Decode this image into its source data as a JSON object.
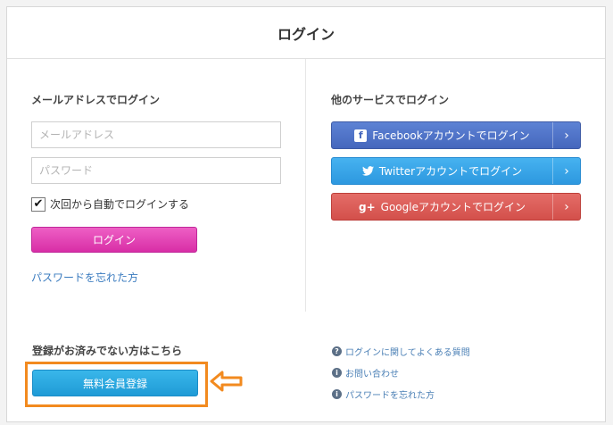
{
  "header": {
    "title": "ログイン"
  },
  "email_login": {
    "title": "メールアドレスでログイン",
    "email_placeholder": "メールアドレス",
    "password_placeholder": "パスワード",
    "remember_label": "次回から自動でログインする",
    "remember_checked": true,
    "login_button": "ログイン",
    "forgot_link": "パスワードを忘れた方"
  },
  "social_login": {
    "title": "他のサービスでログイン",
    "buttons": [
      {
        "label": "Facebookアカウントでログイン",
        "icon": "facebook-icon",
        "color": "#4a6bc2"
      },
      {
        "label": "Twitterアカウントでログイン",
        "icon": "twitter-icon",
        "color": "#34a2e6"
      },
      {
        "label": "Googleアカウントでログイン",
        "icon": "google-plus-icon",
        "glyph": "g+",
        "color": "#d85a55"
      }
    ],
    "arrow_glyph": "›"
  },
  "register": {
    "title": "登録がお済みでない方はこちら",
    "button": "無料会員登録",
    "highlight_color": "#f28a1f"
  },
  "help_links": [
    {
      "label": "ログインに関してよくある質問",
      "icon": "question-icon",
      "glyph": "?"
    },
    {
      "label": "お問い合わせ",
      "icon": "info-icon",
      "glyph": "i"
    },
    {
      "label": "パスワードを忘れた方",
      "icon": "info-icon",
      "glyph": "i"
    }
  ]
}
